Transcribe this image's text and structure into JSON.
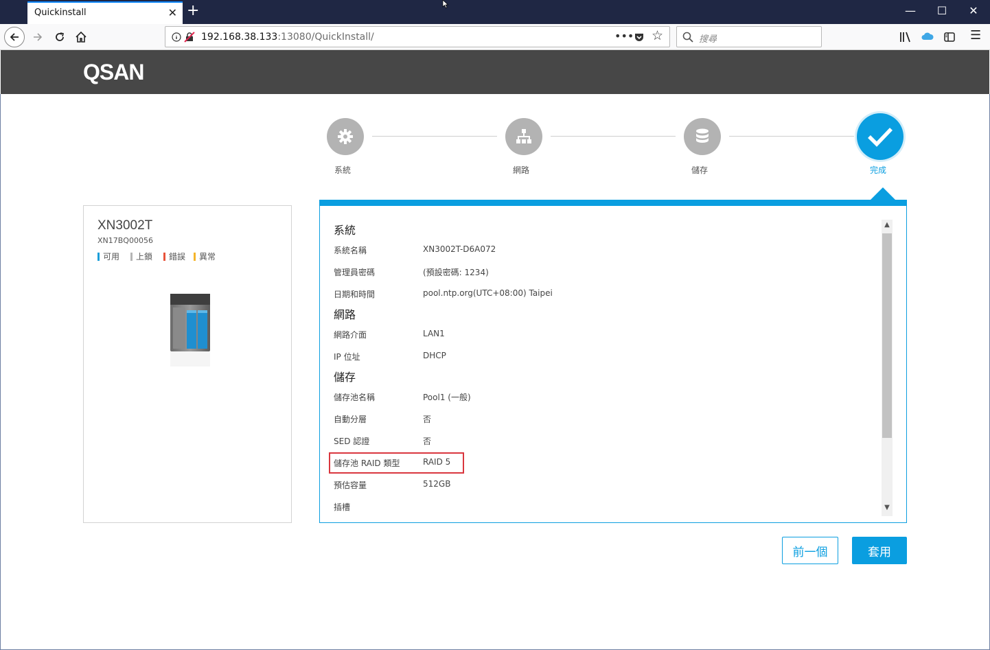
{
  "browser": {
    "tab_title": "Quickinstall",
    "url_host": "192.168.38.133",
    "url_rest": ":13080/QuickInstall/",
    "search_placeholder": "搜尋"
  },
  "app": {
    "logo": "QSAN"
  },
  "stepper": {
    "steps": [
      {
        "label": "系統",
        "icon": "gear-icon"
      },
      {
        "label": "網路",
        "icon": "network-icon"
      },
      {
        "label": "儲存",
        "icon": "database-icon"
      },
      {
        "label": "完成",
        "icon": "check-icon"
      }
    ]
  },
  "device": {
    "model": "XN3002T",
    "serial": "XN17BQ00056",
    "legend": [
      {
        "label": "可用",
        "color": "#1a9ed9"
      },
      {
        "label": "上鎖",
        "color": "#b5b5b5"
      },
      {
        "label": "錯誤",
        "color": "#e8533a"
      },
      {
        "label": "異常",
        "color": "#f5b52a"
      }
    ]
  },
  "summary": {
    "system_title": "系統",
    "system_rows": [
      {
        "label": "系統名稱",
        "value": "XN3002T-D6A072"
      },
      {
        "label": "管理員密碼",
        "value": "(預設密碼: 1234)"
      },
      {
        "label": "日期和時間",
        "value": "pool.ntp.org(UTC+08:00) Taipei"
      }
    ],
    "network_title": "網路",
    "network_rows": [
      {
        "label": "網路介面",
        "value": "LAN1"
      },
      {
        "label": "IP 位址",
        "value": "DHCP"
      }
    ],
    "storage_title": "儲存",
    "storage_rows": [
      {
        "label": "儲存池名稱",
        "value": "Pool1  (一般)"
      },
      {
        "label": "自動分層",
        "value": "否"
      },
      {
        "label": "SED 認證",
        "value": "否"
      },
      {
        "label": "儲存池 RAID 類型",
        "value": "RAID 5"
      },
      {
        "label": "預估容量",
        "value": "512GB"
      },
      {
        "label": "插槽",
        "value": ""
      }
    ]
  },
  "buttons": {
    "prev": "前一個",
    "apply": "套用"
  },
  "colors": {
    "accent": "#0a9ee0",
    "header_bg": "#474747",
    "highlight": "#d9363e"
  }
}
